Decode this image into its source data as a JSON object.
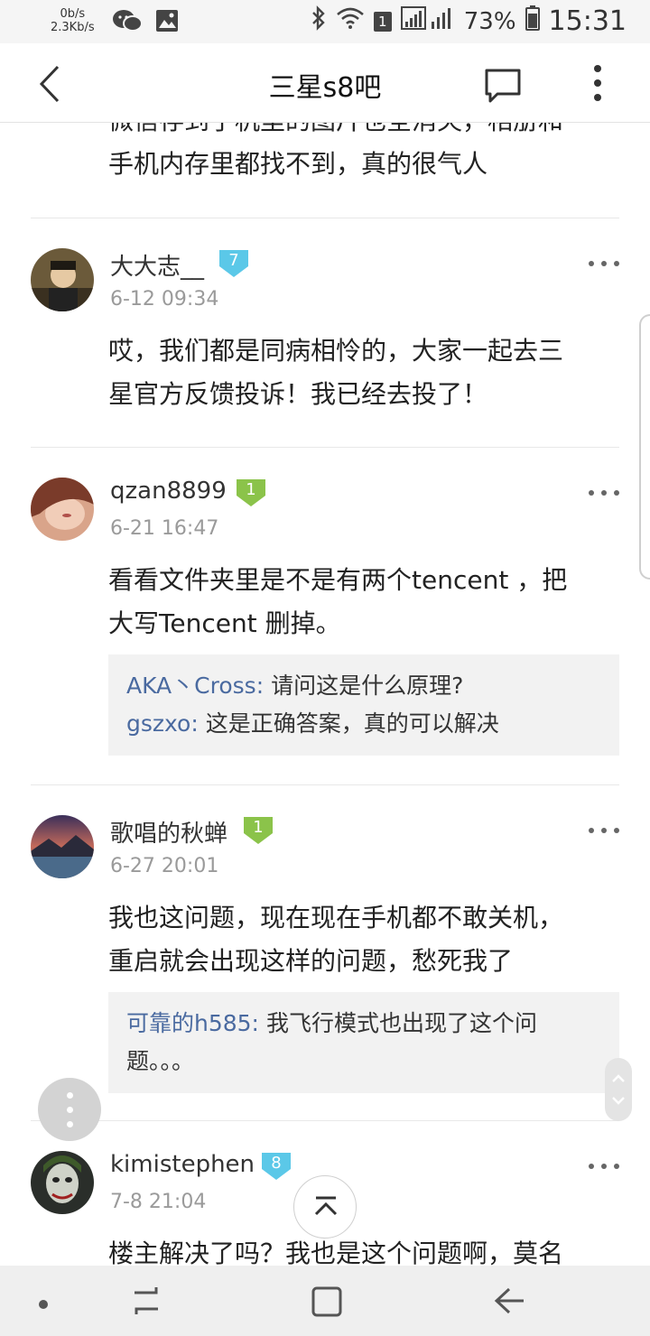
{
  "status_bar": {
    "speed_up": "0b/s",
    "speed_down": "2.3Kb/s",
    "sim": "1",
    "battery": "73%",
    "time": "15:31",
    "icons": [
      "wechat-icon",
      "image-icon",
      "bluetooth-icon",
      "wifi-icon",
      "signal-icon",
      "battery-icon"
    ]
  },
  "nav": {
    "title": "三星s8吧",
    "icons": [
      "back-icon",
      "message-icon",
      "more-vertical-icon"
    ]
  },
  "posts": [
    {
      "lines": [
        "微信存到了机里的图片也全消失，相册和",
        "手机内存里都找不到，真的很气人"
      ]
    },
    {
      "username": "大大志__",
      "level": "7",
      "level_color": "#5bc8e8",
      "time": "6-12 09:34",
      "lines": [
        "哎，我们都是同病相怜的，大家一起去三",
        "星官方反馈投诉！我已经去投了！"
      ]
    },
    {
      "username": "qzan8899",
      "level": "1",
      "level_color": "#8bc34a",
      "time": "6-21 16:47",
      "lines": [
        "看看文件夹里是不是有两个tencent ，把",
        "大写Tencent 删掉。"
      ],
      "replies": [
        {
          "name": "AKA丶Cross:",
          "text": " 请问这是什么原理?"
        },
        {
          "name": "gszxo:",
          "text": " 这是正确答案，真的可以解决"
        }
      ]
    },
    {
      "username": "歌唱的秋蝉",
      "level": "1",
      "level_color": "#8bc34a",
      "time": "6-27 20:01",
      "lines": [
        "我也这问题，现在现在手机都不敢关机，",
        "重启就会出现这样的问题，愁死我了"
      ],
      "replies": [
        {
          "name": "可靠的h585:",
          "text": " 我飞行模式也出现了这个问",
          "text2": "题。。。"
        }
      ]
    },
    {
      "username": "kimistephen",
      "level": "8",
      "level_color": "#5bc8e8",
      "time": "7-8 21:04",
      "lines": [
        "楼主解决了吗？我也是这个问题啊，莫名"
      ]
    }
  ],
  "floating": {
    "menu_icon": "vertical-dots-icon",
    "top_icon": "back-to-top-icon",
    "scroll_icon": "scroll-up-down-icon"
  },
  "system_nav": [
    "dot-icon",
    "recents-icon",
    "home-icon",
    "back-arrow-icon"
  ],
  "colors": {
    "accent_link": "#4a6aa0",
    "level_blue": "#5bc8e8",
    "level_green": "#8bc34a",
    "meta_gray": "#9a9a9a"
  }
}
